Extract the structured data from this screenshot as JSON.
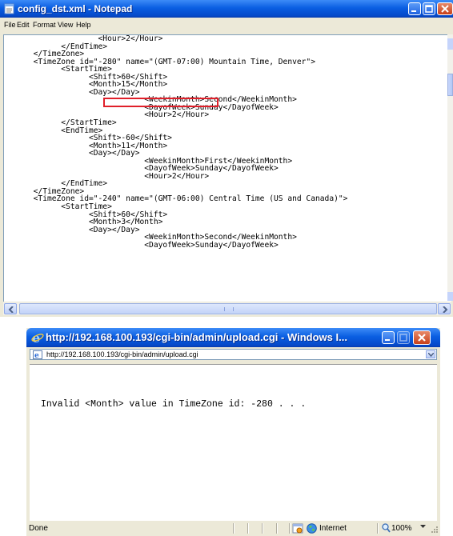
{
  "notepad": {
    "title": "config_dst.xml - Notepad",
    "menu": [
      "File",
      "Edit",
      "Format",
      "View",
      "Help"
    ],
    "lines": [
      "                    <Hour>2</Hour>",
      "            </EndTime>",
      "      </TimeZone>",
      "      <TimeZone id=\"-280\" name=\"(GMT-07:00) Mountain Time, Denver\">",
      "            <StartTime>",
      "                  <Shift>60</Shift>",
      "                  <Month>15</Month>",
      "                  <Day></Day>",
      "                              <WeekinMonth>Second</WeekinMonth>",
      "                              <DayofWeek>Sunday</DayofWeek>",
      "                              <Hour>2</Hour>",
      "            </StartTime>",
      "            <EndTime>",
      "                  <Shift>-60</Shift>",
      "                  <Month>11</Month>",
      "                  <Day></Day>",
      "                              <WeekinMonth>First</WeekinMonth>",
      "                              <DayofWeek>Sunday</DayofWeek>",
      "                              <Hour>2</Hour>",
      "            </EndTime>",
      "      </TimeZone>",
      "      <TimeZone id=\"-240\" name=\"(GMT-06:00) Central Time (US and Canada)\">",
      "            <StartTime>",
      "                  <Shift>60</Shift>",
      "                  <Month>3</Month>",
      "                  <Day></Day>",
      "                              <WeekinMonth>Second</WeekinMonth>",
      "                              <DayofWeek>Sunday</DayofWeek>"
    ],
    "highlight_color": "#e0202a"
  },
  "browser": {
    "title": "http://192.168.100.193/cgi-bin/admin/upload.cgi - Windows I...",
    "address": "http://192.168.100.193/cgi-bin/admin/upload.cgi",
    "message": "Invalid <Month> value in TimeZone id: -280 . . .",
    "status": {
      "left": "Done",
      "zone": "Internet",
      "zoom": "100%"
    }
  },
  "colors": {
    "titlebar": "#0a5ee2",
    "window_face": "#ece9d8"
  }
}
